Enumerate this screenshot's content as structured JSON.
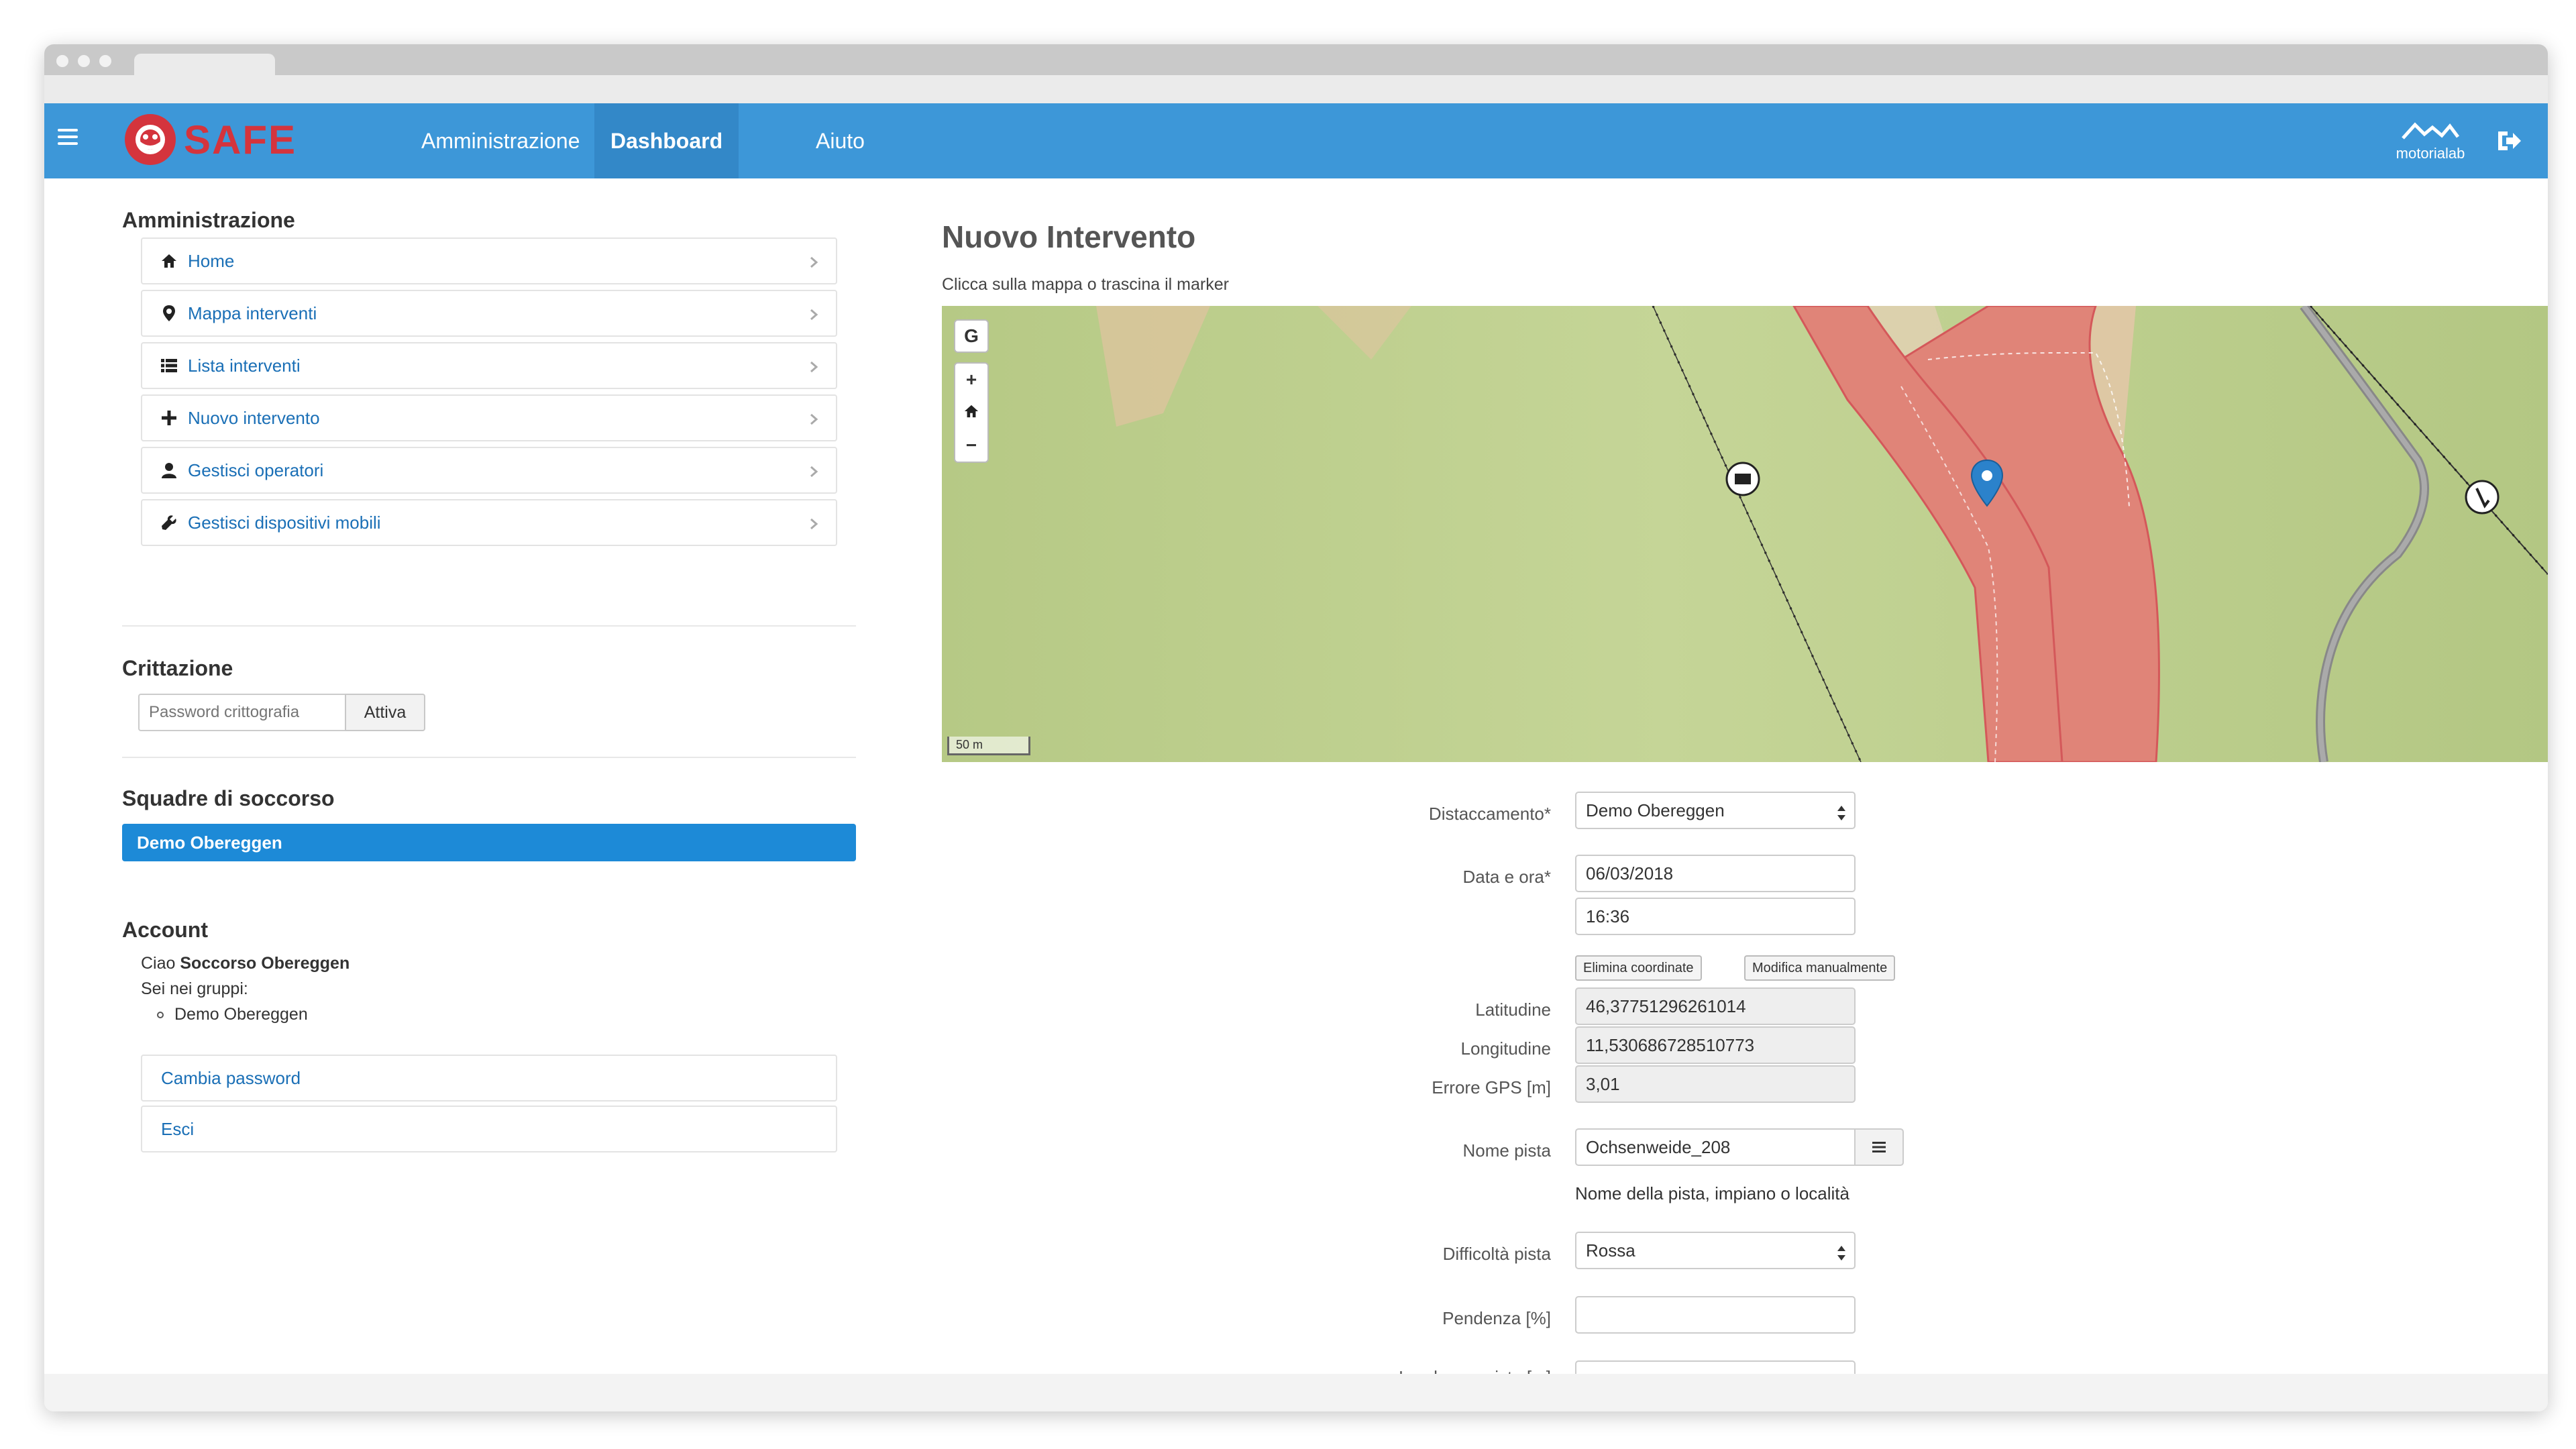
{
  "nav": {
    "logo_text": "SAFE",
    "items": [
      {
        "label": "Amministrazione"
      },
      {
        "label": "Dashboard"
      },
      {
        "label": "Aiuto"
      }
    ],
    "brand_right": "motorialab"
  },
  "sidebar": {
    "admin_heading": "Amministrazione",
    "menu": [
      {
        "label": "Home",
        "icon": "home-icon"
      },
      {
        "label": "Mappa interventi",
        "icon": "map-marker-icon"
      },
      {
        "label": "Lista interventi",
        "icon": "list-icon"
      },
      {
        "label": "Nuovo intervento",
        "icon": "plus-icon"
      },
      {
        "label": "Gestisci operatori",
        "icon": "user-icon"
      },
      {
        "label": "Gestisci dispositivi mobili",
        "icon": "wrench-icon"
      }
    ],
    "crypt_heading": "Crittazione",
    "crypt_placeholder": "Password crittografia",
    "crypt_button": "Attiva",
    "teams_heading": "Squadre di soccorso",
    "team_selected": "Demo Obereggen",
    "account_heading": "Account",
    "greeting_prefix": "Ciao",
    "greeting_name": "Soccorso Obereggen",
    "groups_label": "Sei nei gruppi:",
    "group_item": "Demo Obereggen",
    "change_password": "Cambia password",
    "logout": "Esci"
  },
  "main": {
    "title": "Nuovo Intervento",
    "hint": "Clicca sulla mappa o trascina il marker",
    "map": {
      "ctrl_g": "G",
      "zoom_in": "+",
      "zoom_out": "−",
      "scale_label": "50 m"
    },
    "form": {
      "distaccamento_label": "Distaccamento*",
      "distaccamento_value": "Demo Obereggen",
      "data_ora_label": "Data e ora*",
      "date_value": "06/03/2018",
      "time_value": "16:36",
      "btn_clear_coords": "Elimina coordinate",
      "btn_manual": "Modifica manualmente",
      "lat_label": "Latitudine",
      "lat_value": "46,37751296261014",
      "lon_label": "Longitudine",
      "lon_value": "11,530686728510773",
      "gps_label": "Errore GPS [m]",
      "gps_value": "3,01",
      "pista_label": "Nome pista",
      "pista_value": "Ochsenweide_208",
      "pista_help": "Nome della pista, impiano o località",
      "difficolta_label": "Difficoltà pista",
      "difficolta_value": "Rossa",
      "pendenza_label": "Pendenza [%]",
      "pendenza_value": "",
      "larghezza_label": "Larghezza pista [m]"
    }
  },
  "colors": {
    "navbar": "#3d97d8",
    "brand_red": "#d4343d",
    "link": "#1a6fb6",
    "team_active": "#1d8ad7",
    "map_green": "#b8cc86",
    "piste_red": "#e08478"
  }
}
